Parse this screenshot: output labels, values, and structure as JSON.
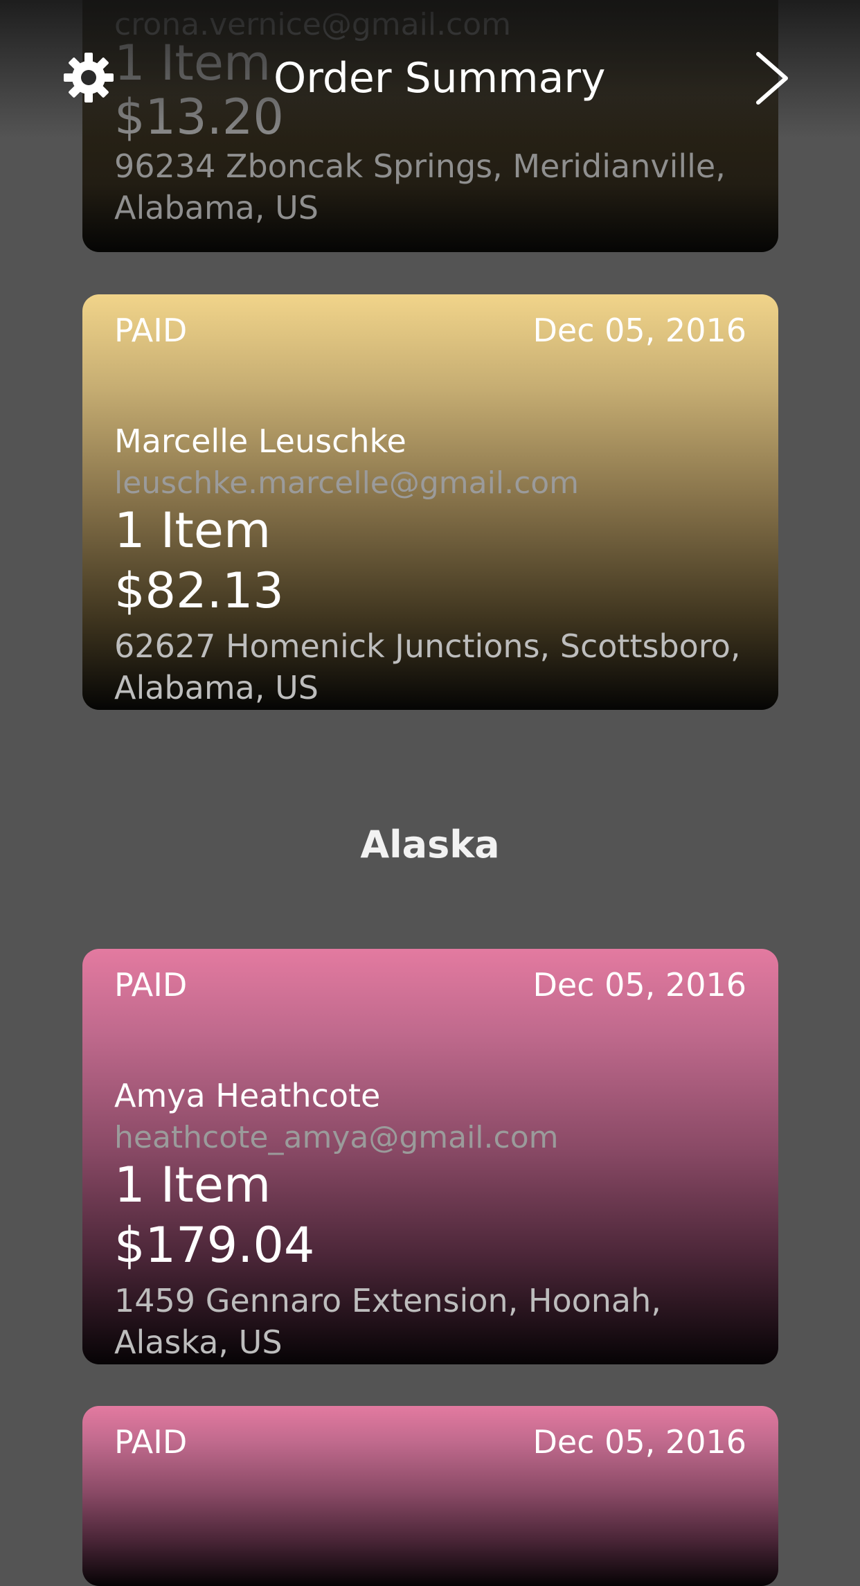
{
  "header": {
    "title": "Order Summary",
    "settings_icon": "gear-icon",
    "next_icon": "chevron-right-icon"
  },
  "orders_top": {
    "email": "crona.vernice@gmail.com",
    "items": "1 Item",
    "price": "$13.20",
    "address": "96234 Zboncak Springs, Meridianville, Alabama, US"
  },
  "orders_alabama": {
    "status": "PAID",
    "date": "Dec 05, 2016",
    "name": "Marcelle Leuschke",
    "email": "leuschke.marcelle@gmail.com",
    "items": "1 Item",
    "price": "$82.13",
    "address": "62627 Homenick Junctions, Scottsboro, Alabama, US"
  },
  "section": {
    "title": "Alaska"
  },
  "orders_alaska": [
    {
      "status": "PAID",
      "date": "Dec 05, 2016",
      "name": "Amya Heathcote",
      "email": "heathcote_amya@gmail.com",
      "items": "1 Item",
      "price": "$179.04",
      "address": "1459 Gennaro Extension, Hoonah, Alaska, US"
    },
    {
      "status": "PAID",
      "date": "Dec 05, 2016"
    }
  ],
  "colors": {
    "background": "#545454",
    "gold_card_top": "#f1d48a",
    "pink_card_top": "#e37aa0"
  }
}
